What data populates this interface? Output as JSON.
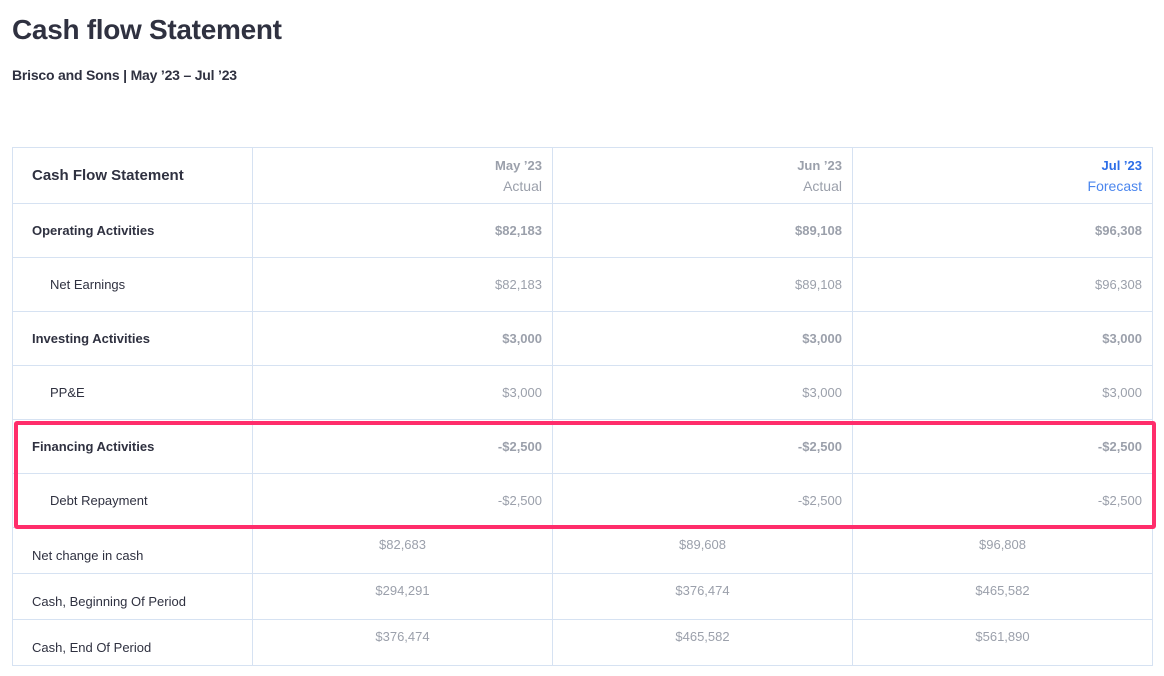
{
  "page": {
    "title": "Cash flow Statement",
    "subtitle": "Brisco and Sons | May ’23 – Jul ’23"
  },
  "table": {
    "header": {
      "label": "Cash Flow Statement",
      "columns": [
        {
          "month": "May ’23",
          "type": "Actual"
        },
        {
          "month": "Jun ’23",
          "type": "Actual"
        },
        {
          "month": "Jul ’23",
          "type": "Forecast"
        }
      ]
    },
    "rows": [
      {
        "label": "Operating Activities",
        "values": [
          "$82,183",
          "$89,108",
          "$96,308"
        ]
      },
      {
        "label": "Net Earnings",
        "values": [
          "$82,183",
          "$89,108",
          "$96,308"
        ]
      },
      {
        "label": "Investing Activities",
        "values": [
          "$3,000",
          "$3,000",
          "$3,000"
        ]
      },
      {
        "label": "PP&E",
        "values": [
          "$3,000",
          "$3,000",
          "$3,000"
        ]
      },
      {
        "label": "Financing Activities",
        "values": [
          "-$2,500",
          "-$2,500",
          "-$2,500"
        ]
      },
      {
        "label": "Debt Repayment",
        "values": [
          "-$2,500",
          "-$2,500",
          "-$2,500"
        ]
      }
    ],
    "summary": [
      {
        "label": "Net change in cash",
        "values": [
          "$82,683",
          "$89,608",
          "$96,808"
        ]
      },
      {
        "label": "Cash, Beginning Of Period",
        "values": [
          "$294,291",
          "$376,474",
          "$465,582"
        ]
      },
      {
        "label": "Cash, End Of Period",
        "values": [
          "$376,474",
          "$465,582",
          "$561,890"
        ]
      }
    ]
  },
  "colors": {
    "highlight": "#ff2d6b",
    "forecast": "#2d6ee8",
    "border": "#d6e2f2"
  }
}
